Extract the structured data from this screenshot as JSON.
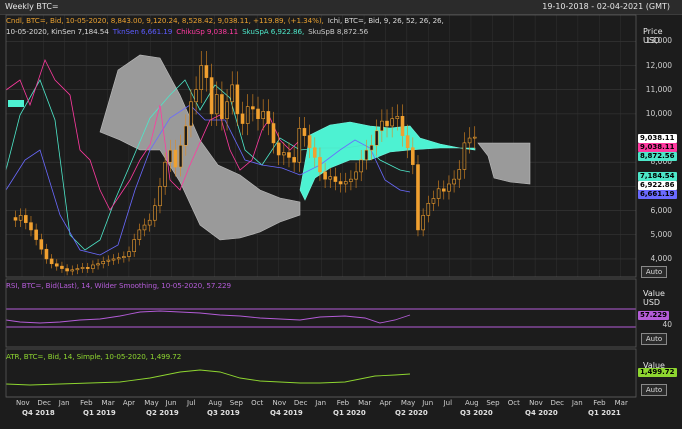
{
  "window": {
    "title": "Weekly BTC=",
    "date_range": "19-10-2018 - 02-04-2021 (GMT)"
  },
  "price_panel": {
    "legend_line1": [
      {
        "text": "Cndl, BTC=, Bid, 10-05-2020, 8,843.00, 9,120.24, 8,528.42, 9,038.11, +119.89, (+1.34%),",
        "color": "#e8a030"
      },
      {
        "text": "Ichi, BTC=, Bid,  9, 26, 52, 26, 26,",
        "color": "#d8d8d8"
      }
    ],
    "legend_line2": [
      {
        "text": "10-05-2020, KinSen 7,184.54",
        "color": "#d8d8d8"
      },
      {
        "text": "TknSen 6,661.19",
        "color": "#5b5bff"
      },
      {
        "text": "ChikuSp 9,038.11",
        "color": "#ff3aa0"
      },
      {
        "text": "SkuSpA 6,922.86,",
        "color": "#4de7c9"
      },
      {
        "text": "SkuSpB 8,872.56",
        "color": "#c8c8c8"
      }
    ],
    "axis_title": [
      "Price",
      "USD"
    ],
    "ticks": [
      "13,000",
      "12,000",
      "11,000",
      "10,000",
      "8,000",
      "7,000",
      "6,000",
      "5,000",
      "4,000"
    ],
    "badges": [
      {
        "text": "9,038.11",
        "bg": "#ffffff",
        "fg": "#000000"
      },
      {
        "text": "9,038.11",
        "bg": "#ff3aa0",
        "fg": "#000000"
      },
      {
        "text": "8,872.56",
        "bg": "#4de7c9",
        "fg": "#000000"
      },
      {
        "text": "7,184.54",
        "bg": "#4de7c9",
        "fg": "#000000"
      },
      {
        "text": "6,922.86",
        "bg": "#ffffff",
        "fg": "#000000"
      },
      {
        "text": "6,661.19",
        "bg": "#6a6aff",
        "fg": "#000000"
      }
    ],
    "auto": "Auto"
  },
  "rsi_panel": {
    "legend": "RSI, BTC=, Bid(Last),  14, Wilder Smoothing, 10-05-2020, 57.229",
    "color": "#b45cd8",
    "axis_title": [
      "Value",
      "USD"
    ],
    "value_badge": "57.229",
    "tick": "40",
    "auto": "Auto"
  },
  "atr_panel": {
    "legend": "ATR, BTC=, Bid,  14, Simple, 10-05-2020, 1,499.72",
    "color": "#8ed630",
    "axis_title": [
      "Value",
      "USD"
    ],
    "value_badge": "1,499.72",
    "auto": "Auto"
  },
  "x_axis": {
    "months": [
      "Nov",
      "Dec",
      "Jan",
      "Feb",
      "Mar",
      "Apr",
      "May",
      "Jun",
      "Jul",
      "Aug",
      "Sep",
      "Oct",
      "Nov",
      "Dec",
      "Jan",
      "Feb",
      "Mar",
      "Apr",
      "May",
      "Jun",
      "Jul",
      "Aug",
      "Sep",
      "Oct",
      "Nov",
      "Dec",
      "Jan",
      "Feb",
      "Mar"
    ],
    "quarters": [
      "Q4 2018",
      "Q1 2019",
      "Q2 2019",
      "Q3 2019",
      "Q4 2019",
      "Q1 2020",
      "Q2 2020",
      "Q3 2020",
      "Q4 2020",
      "Q1 2021"
    ]
  },
  "chart_data": {
    "type": "candlestick",
    "instrument": "BTC=",
    "x": [
      "2018-11",
      "2018-12",
      "2019-01",
      "2019-02",
      "2019-03",
      "2019-04",
      "2019-05",
      "2019-06",
      "2019-07",
      "2019-08",
      "2019-09",
      "2019-10",
      "2019-11",
      "2019-12",
      "2020-01",
      "2020-02",
      "2020-03",
      "2020-04",
      "2020-05"
    ],
    "close_approx": [
      5600,
      3800,
      3500,
      3800,
      4000,
      5200,
      8500,
      10800,
      10000,
      9600,
      8300,
      9100,
      7500,
      7200,
      9300,
      8600,
      6400,
      8600,
      9038.11
    ],
    "ylabel": "Price USD",
    "ylim": [
      3500,
      13800
    ],
    "last_values": {
      "close": 9038.11,
      "KinSen": 7184.54,
      "TknSen": 6661.19,
      "ChikuSp": 9038.11,
      "SkuSpA": 6922.86,
      "SkuSpB": 8872.56
    },
    "rsi_last": 57.229,
    "atr_last": 1499.72
  }
}
